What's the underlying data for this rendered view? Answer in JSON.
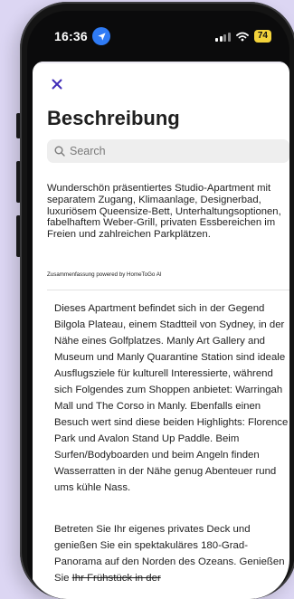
{
  "status_bar": {
    "time": "16:36",
    "battery": "74",
    "location_icon": "location-arrow-icon",
    "signal_icon": "cellular-signal-icon",
    "wifi_icon": "wifi-icon"
  },
  "sheet": {
    "close_icon": "close-icon",
    "title": "Beschreibung",
    "search": {
      "placeholder": "Search",
      "icon": "search-icon"
    },
    "summary": "Wunderschön präsentiertes Studio-Apartment mit separatem Zugang, Klimaanlage, Designerbad, luxuriösem Queensize-Bett, Unterhaltungsoptionen, fabelhaftem Weber-Grill, privaten Essbereichen im Freien und zahlreichen Parkplätzen.",
    "powered_by": "Zusammenfassung powered by HomeToGo AI",
    "description_1": "Dieses Apartment befindet sich in der Gegend Bilgola Plateau, einem Stadtteil von Sydney, in der Nähe eines Golfplatzes. Manly Art Gallery and Museum und Manly Quarantine Station sind ideale Ausflugsziele für kulturell Interessierte, während sich Folgendes zum Shoppen anbietet: Warringah Mall und The Corso in Manly. Ebenfalls einen Besuch wert sind diese beiden Highlights: Florence Park und Avalon Stand Up Paddle. Beim Surfen/Bodyboarden und beim Angeln finden Wasserratten in der Nähe genug Abenteuer rund ums kühle Nass.",
    "description_2_main": "Betreten Sie Ihr eigenes privates Deck und genießen Sie ein spektakuläres 180-Grad-Panorama auf den Norden des Ozeans. Genießen Sie ",
    "description_2_cut": "Ihr Frühstück in der"
  },
  "colors": {
    "background": "#dcd6f3",
    "accent": "#3f2bb8",
    "battery": "#f3d33b",
    "location": "#2f7bf5"
  }
}
